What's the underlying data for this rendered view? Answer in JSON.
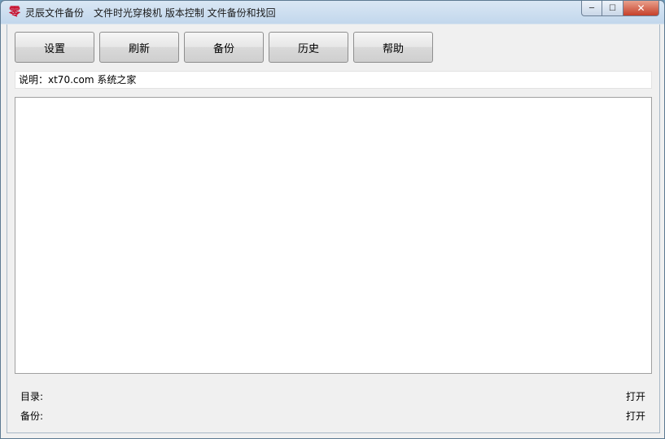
{
  "window": {
    "title": "灵辰文件备份　文件时光穿梭机 版本控制 文件备份和找回",
    "app_icon_glyph": "零",
    "controls": {
      "minimize": "─",
      "maximize": "☐",
      "close": "✕"
    }
  },
  "toolbar": {
    "settings_label": "设置",
    "refresh_label": "刷新",
    "backup_label": "备份",
    "history_label": "历史",
    "help_label": "帮助"
  },
  "description": "说明：xt70.com 系统之家",
  "directory": {
    "label": "目录:",
    "value": "",
    "open_label": "打开"
  },
  "backup_path": {
    "label": "备份:",
    "value": "",
    "open_label": "打开"
  },
  "colors": {
    "accent": "#c8102e",
    "client_bg": "#f0f0f0"
  }
}
